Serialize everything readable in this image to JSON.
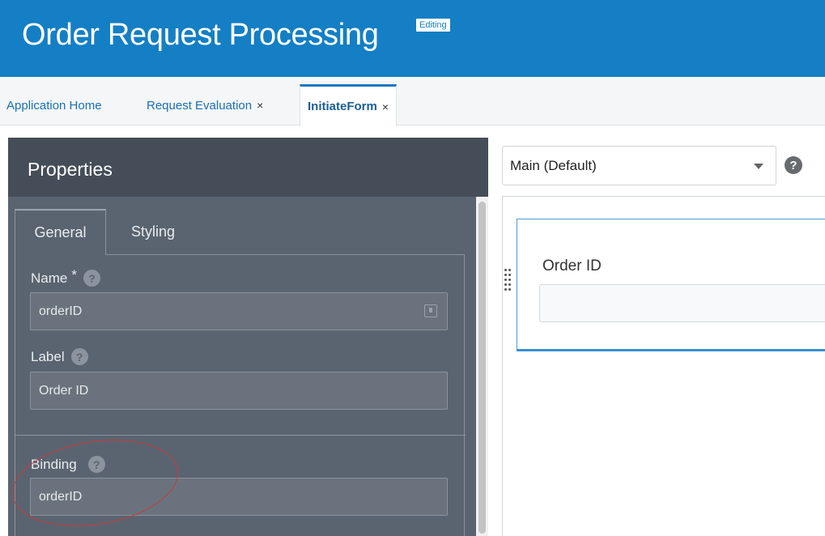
{
  "header": {
    "title": "Order Request Processing",
    "badge": "Editing",
    "bg_color": "#147fc4"
  },
  "tabs": [
    {
      "label": "Application Home",
      "closable": false,
      "active": false
    },
    {
      "label": "Request Evaluation",
      "closable": true,
      "active": false
    },
    {
      "label": "InitiateForm",
      "closable": true,
      "active": true
    }
  ],
  "close_glyph": "×",
  "properties": {
    "title": "Properties",
    "tabs": [
      {
        "label": "General",
        "active": true
      },
      {
        "label": "Styling",
        "active": false
      }
    ],
    "name_field": {
      "label": "Name",
      "required_mark": "*",
      "value": "orderID"
    },
    "label_field": {
      "label": "Label",
      "value": "Order ID"
    },
    "binding_field": {
      "label": "Binding",
      "value": "orderID"
    },
    "help_glyph": "?"
  },
  "designer": {
    "layout_select": {
      "value": "Main (Default)"
    },
    "help_glyph": "?",
    "field_label": "Order ID",
    "field_value": ""
  },
  "annotation": {
    "color": "#c93a3a"
  }
}
